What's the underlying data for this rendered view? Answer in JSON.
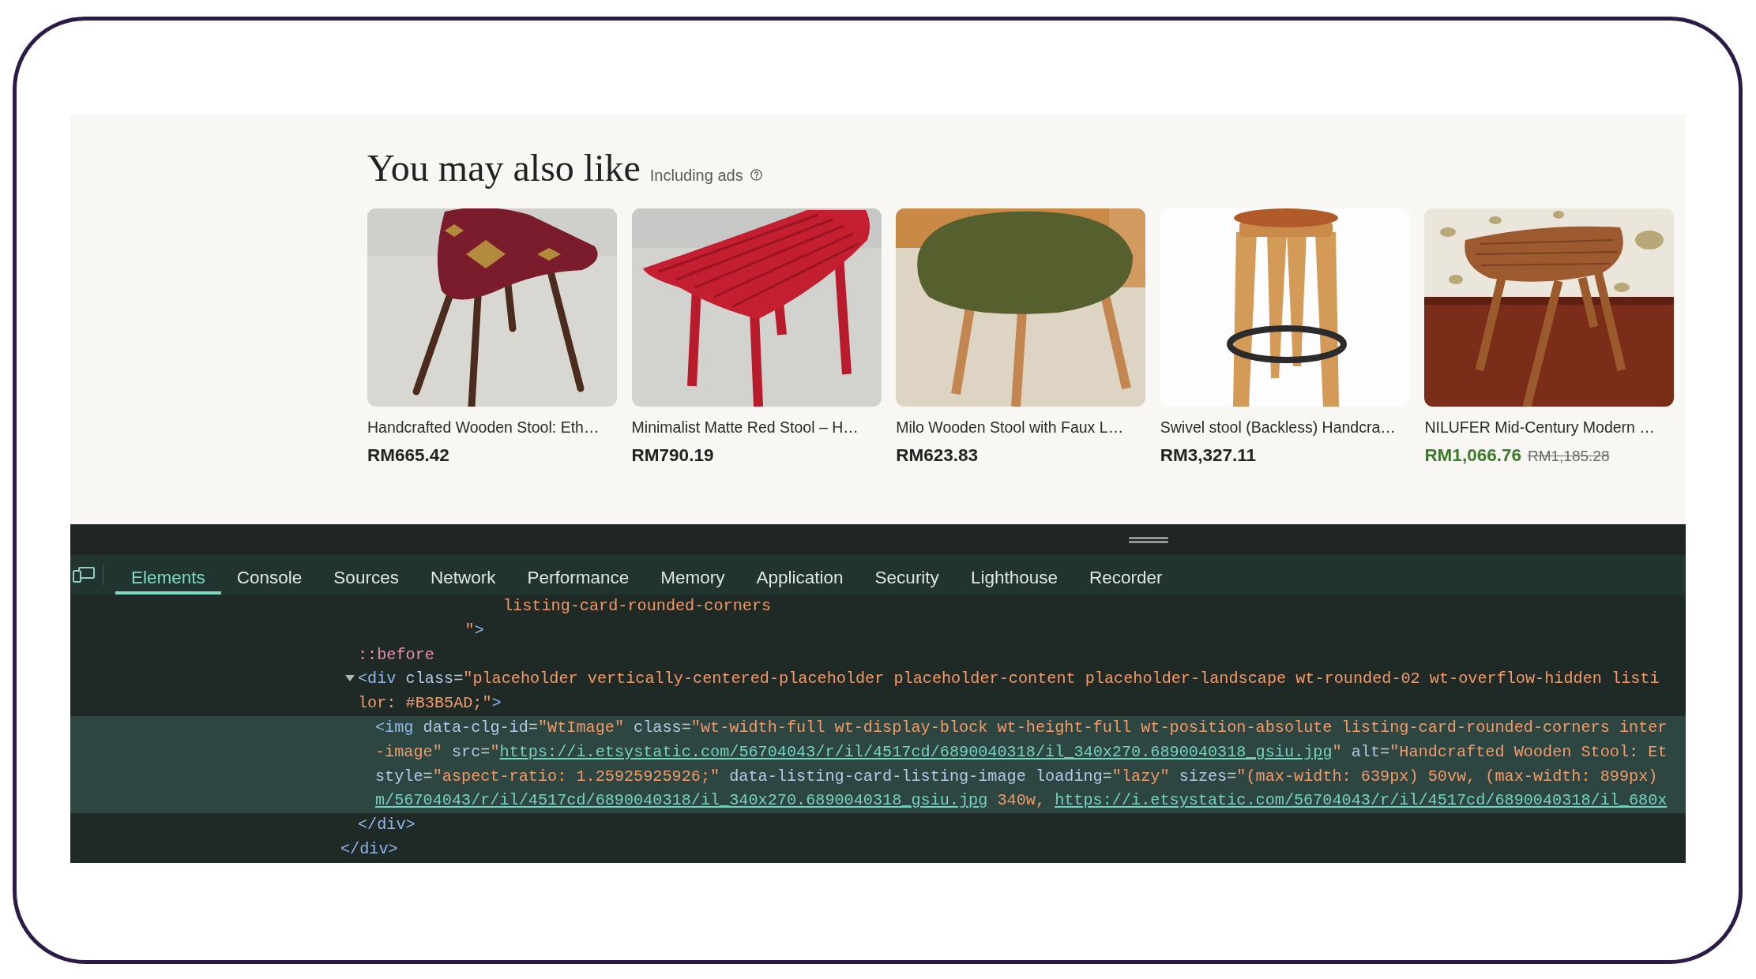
{
  "recommendations": {
    "title": "You may also like",
    "note": "Including ads",
    "cards": [
      {
        "title": "Handcrafted Wooden Stool: Eth…",
        "price": "RM665.42",
        "discounted": false
      },
      {
        "title": "Minimalist Matte Red Stool – H…",
        "price": "RM790.19",
        "discounted": false
      },
      {
        "title": "Milo Wooden Stool with Faux L…",
        "price": "RM623.83",
        "discounted": false
      },
      {
        "title": "Swivel stool (Backless) Handcra…",
        "price": "RM3,327.11",
        "discounted": false
      },
      {
        "title": "NILUFER Mid-Century Modern …",
        "price": "RM1,066.76",
        "discounted": true,
        "original_price": "RM1,185.28"
      }
    ]
  },
  "devtools": {
    "tabs": [
      {
        "label": "Elements",
        "selected": true
      },
      {
        "label": "Console",
        "selected": false
      },
      {
        "label": "Sources",
        "selected": false
      },
      {
        "label": "Network",
        "selected": false
      },
      {
        "label": "Performance",
        "selected": false
      },
      {
        "label": "Memory",
        "selected": false
      },
      {
        "label": "Application",
        "selected": false
      },
      {
        "label": "Security",
        "selected": false
      },
      {
        "label": "Lighthouse",
        "selected": false
      },
      {
        "label": "Recorder",
        "selected": false
      }
    ],
    "dom_tree": [
      {
        "selected": false,
        "lines": [
          [
            {
              "kind": "value",
              "text": "                 listing-card-rounded-corners"
            }
          ],
          [
            {
              "kind": "value",
              "text": "             \""
            },
            {
              "kind": "tag",
              "text": ">"
            }
          ]
        ],
        "children": [
          {
            "selected": false,
            "lines": [
              [
                {
                  "kind": "pseudo",
                  "text": "::before"
                }
              ]
            ]
          },
          {
            "selected": false,
            "expanded": true,
            "lines": [
              [
                {
                  "kind": "tag",
                  "text": "<div"
                },
                {
                  "kind": "attr",
                  "text": " class"
                },
                {
                  "kind": "punct",
                  "text": "="
                },
                {
                  "kind": "value",
                  "text": "\"placeholder vertically-centered-placeholder placeholder-content placeholder-landscape wt-rounded-02 wt-overflow-hidden listi"
                }
              ],
              [
                {
                  "kind": "value",
                  "text": "lor: #B3B5AD;\""
                },
                {
                  "kind": "tag",
                  "text": ">"
                }
              ]
            ],
            "children": [
              {
                "selected": true,
                "lines": [
                  [
                    {
                      "kind": "tag",
                      "text": "<img"
                    },
                    {
                      "kind": "attr",
                      "text": " data-clg-id"
                    },
                    {
                      "kind": "punct",
                      "text": "="
                    },
                    {
                      "kind": "value",
                      "text": "\"WtImage\""
                    },
                    {
                      "kind": "attr",
                      "text": " class"
                    },
                    {
                      "kind": "punct",
                      "text": "="
                    },
                    {
                      "kind": "value",
                      "text": "\"wt-width-full wt-display-block wt-height-full wt-position-absolute listing-card-rounded-corners inter"
                    }
                  ],
                  [
                    {
                      "kind": "value",
                      "text": "-image\""
                    },
                    {
                      "kind": "attr",
                      "text": " src"
                    },
                    {
                      "kind": "punct",
                      "text": "="
                    },
                    {
                      "kind": "value",
                      "text": "\""
                    },
                    {
                      "kind": "link",
                      "text": "https://i.etsystatic.com/56704043/r/il/4517cd/6890040318/il_340x270.6890040318_gsiu.jpg"
                    },
                    {
                      "kind": "value",
                      "text": "\""
                    },
                    {
                      "kind": "attr",
                      "text": " alt"
                    },
                    {
                      "kind": "punct",
                      "text": "="
                    },
                    {
                      "kind": "value",
                      "text": "\"Handcrafted Wooden Stool: Et"
                    }
                  ],
                  [
                    {
                      "kind": "attr",
                      "text": "style"
                    },
                    {
                      "kind": "punct",
                      "text": "="
                    },
                    {
                      "kind": "value",
                      "text": "\"aspect-ratio: 1.25925925926;\""
                    },
                    {
                      "kind": "attr",
                      "text": " data-listing-card-listing-image loading"
                    },
                    {
                      "kind": "punct",
                      "text": "="
                    },
                    {
                      "kind": "value",
                      "text": "\"lazy\""
                    },
                    {
                      "kind": "attr",
                      "text": " sizes"
                    },
                    {
                      "kind": "punct",
                      "text": "="
                    },
                    {
                      "kind": "value",
                      "text": "\"(max-width: 639px) 50vw, (max-width: 899px)"
                    }
                  ],
                  [
                    {
                      "kind": "link",
                      "text": "m/56704043/r/il/4517cd/6890040318/il_340x270.6890040318_gsiu.jpg"
                    },
                    {
                      "kind": "value",
                      "text": " 340w, "
                    },
                    {
                      "kind": "link",
                      "text": "https://i.etsystatic.com/56704043/r/il/4517cd/6890040318/il_680x"
                    }
                  ]
                ]
              }
            ],
            "close": "</div>"
          }
        ],
        "close": "</div>"
      }
    ]
  }
}
